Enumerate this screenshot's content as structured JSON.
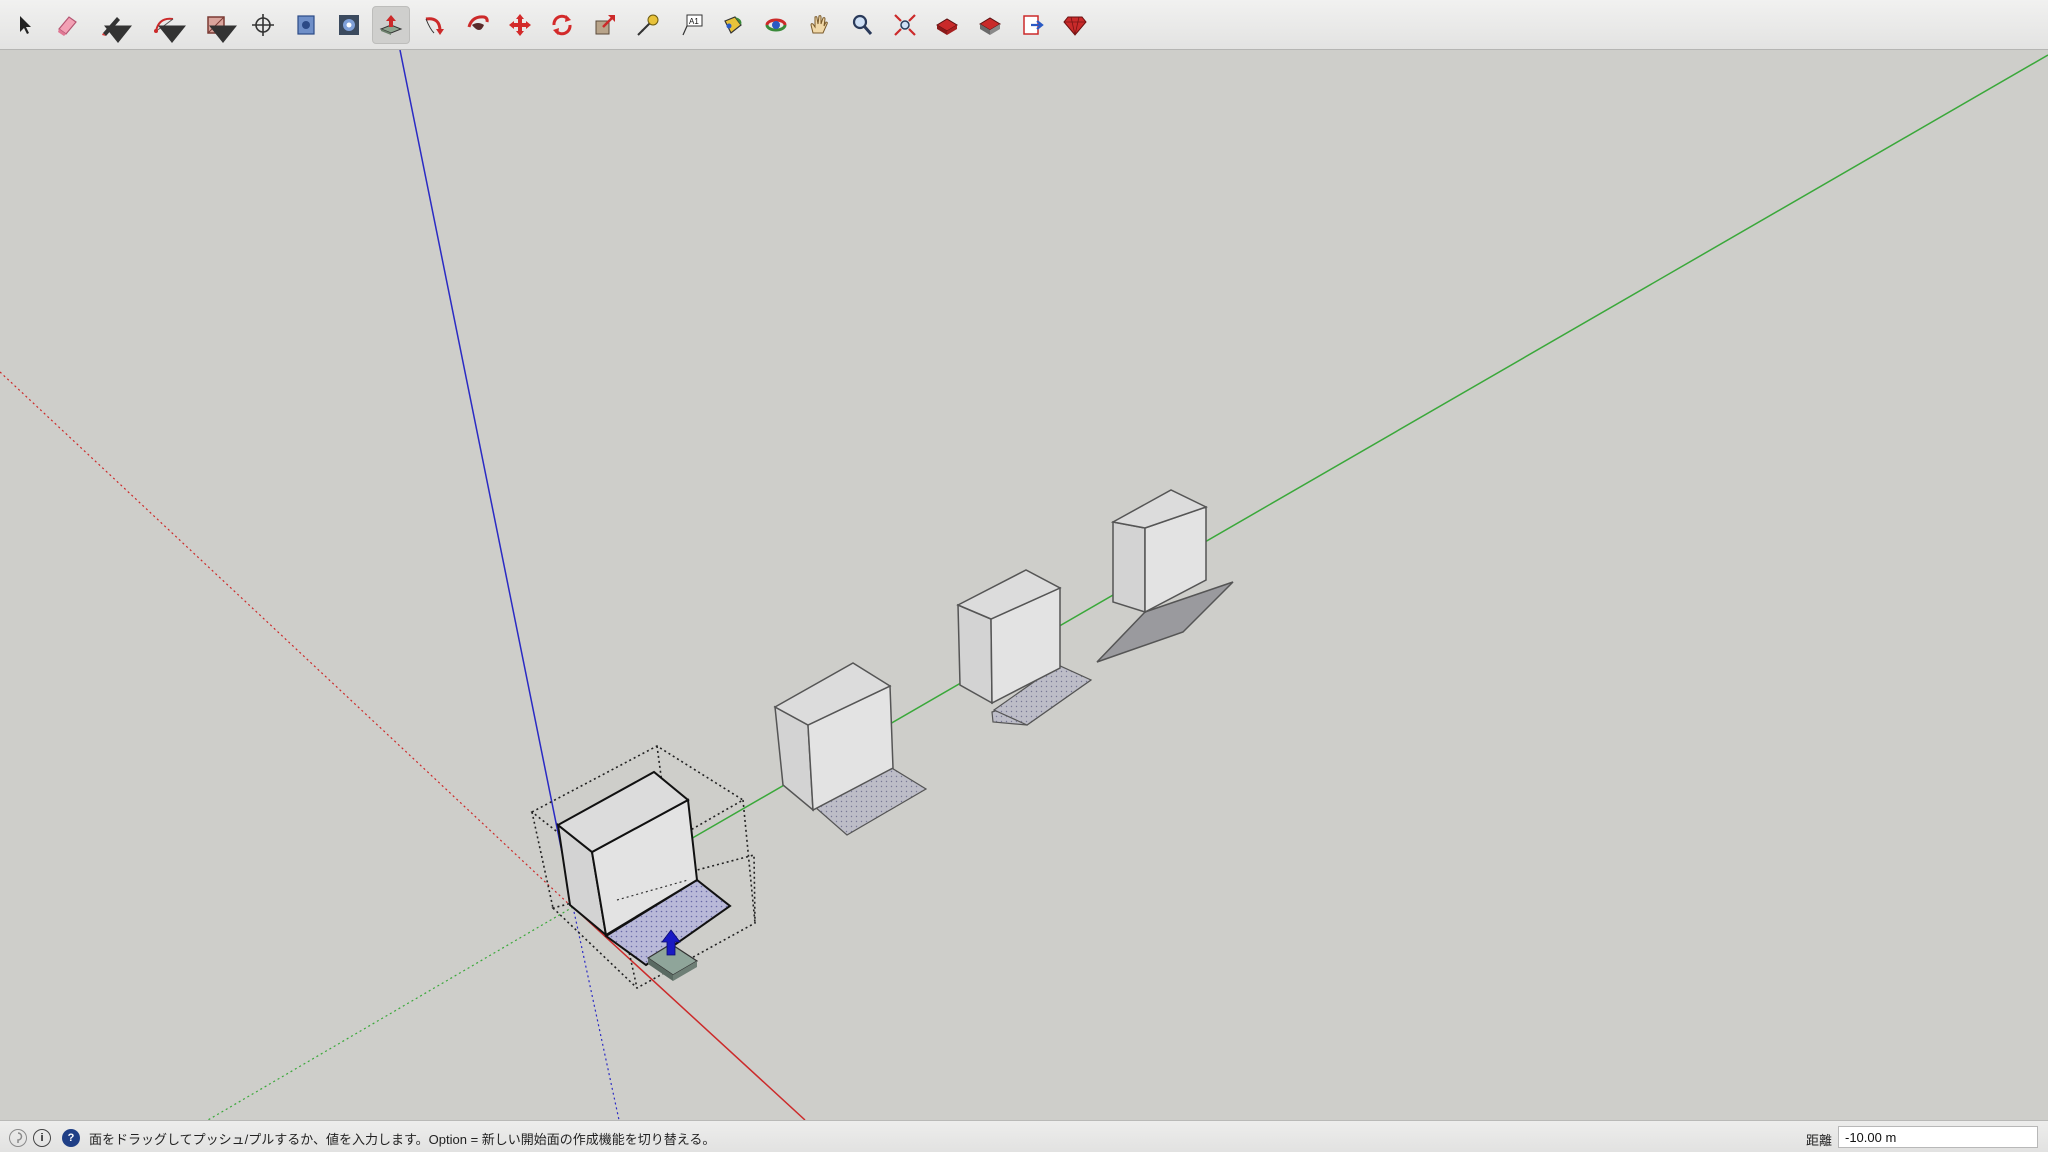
{
  "toolbar": {
    "tools": [
      {
        "name": "select-tool",
        "icon": "arrow-cursor-icon"
      },
      {
        "name": "eraser-tool",
        "icon": "eraser-icon"
      },
      {
        "name": "line-tool",
        "icon": "pencil-icon",
        "dropdown": true
      },
      {
        "name": "arc-tool",
        "icon": "arc-icon",
        "dropdown": true
      },
      {
        "name": "rectangle-tool",
        "icon": "rectangle-icon",
        "dropdown": true
      },
      {
        "name": "orbit-position-tool",
        "icon": "crosshair-icon"
      },
      {
        "name": "offset-tool",
        "icon": "offset-icon"
      },
      {
        "name": "follow-me-tool",
        "icon": "follow-me-icon"
      },
      {
        "name": "push-pull-tool",
        "icon": "push-pull-icon",
        "active": true
      },
      {
        "name": "follow-path-tool",
        "icon": "curved-arrow-icon"
      },
      {
        "name": "paint-bucket-tool",
        "icon": "paint-bucket-icon"
      },
      {
        "name": "move-tool",
        "icon": "move-arrows-icon"
      },
      {
        "name": "rotate-tool",
        "icon": "rotate-icon"
      },
      {
        "name": "scale-tool",
        "icon": "scale-icon"
      },
      {
        "name": "tape-measure-tool",
        "icon": "tape-measure-icon"
      },
      {
        "name": "text-tool",
        "icon": "text-label-icon",
        "label": "A1"
      },
      {
        "name": "paint-tool",
        "icon": "paint-icon"
      },
      {
        "name": "orbit-tool",
        "icon": "orbit-icon"
      },
      {
        "name": "pan-tool",
        "icon": "hand-icon"
      },
      {
        "name": "zoom-tool",
        "icon": "magnifier-icon"
      },
      {
        "name": "zoom-extents-tool",
        "icon": "zoom-extents-icon"
      },
      {
        "name": "warehouse-tool",
        "icon": "warehouse-icon"
      },
      {
        "name": "extension-warehouse-tool",
        "icon": "extension-warehouse-icon"
      },
      {
        "name": "share-model-tool",
        "icon": "share-model-icon"
      },
      {
        "name": "ruby-console-tool",
        "icon": "ruby-icon"
      }
    ]
  },
  "status": {
    "message": "面をドラッグしてプッシュ/プルするか、値を入力します。Option = 新しい開始面の作成機能を切り替える。",
    "help_symbol": "?",
    "credit_symbol": "i"
  },
  "measurements": {
    "label": "距離",
    "value": "-10.00 m"
  },
  "colors": {
    "viewport_bg": "#cececa",
    "axis_red": "#cc2a2a",
    "axis_green": "#3aa83a",
    "axis_blue": "#2a2ac4",
    "face_selected": "#b9b9d8",
    "face_default": "#e3e3e3"
  }
}
